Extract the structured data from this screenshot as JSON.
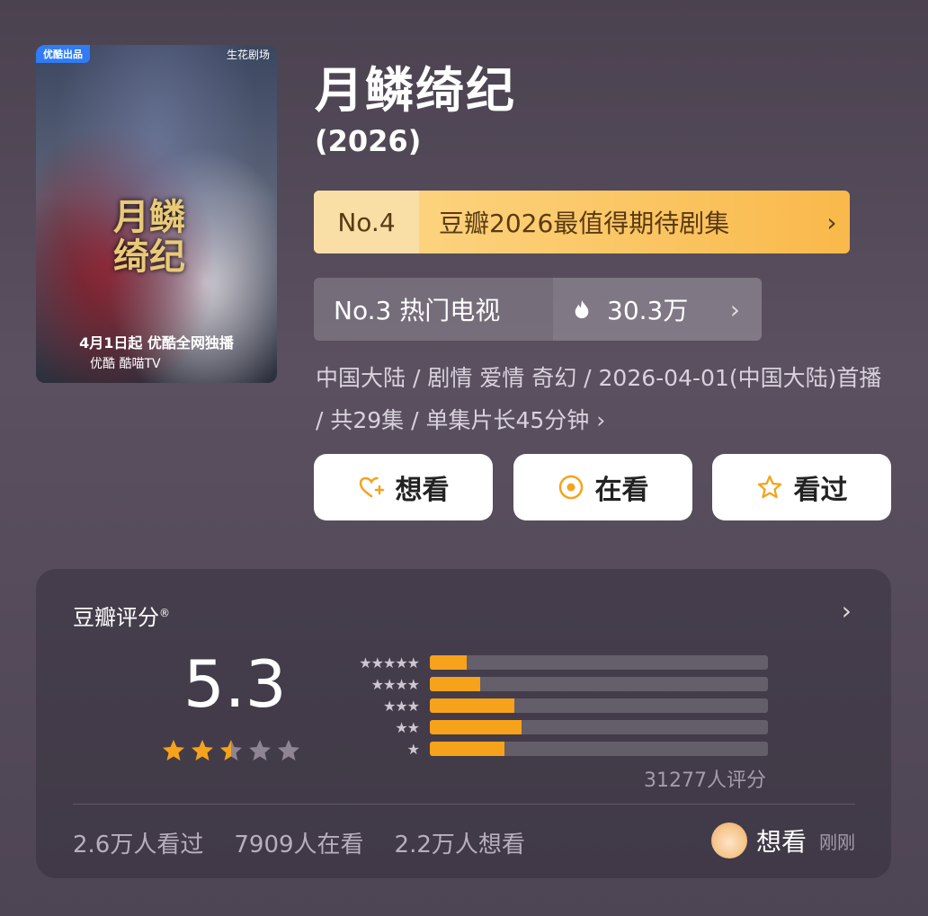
{
  "poster": {
    "badge": "优酷出品",
    "brand": "生花剧场",
    "title_art": "月鳞绮纪",
    "release": "4月1日起 优酷全网独播",
    "platforms": "优酷 酷喵TV"
  },
  "show": {
    "title": "月鳞绮纪",
    "year": "(2026)"
  },
  "rank_main": {
    "num": "No.4",
    "label": "豆瓣2026最值得期待剧集",
    "chevron": "›"
  },
  "rank_sub": {
    "label": "No.3 热门电视",
    "heat": "30.3万",
    "chevron": "›",
    "icon": "flame-icon"
  },
  "meta": {
    "line": "中国大陆 / 剧情 爱情 奇幻 / 2026-04-01(中国大陆)首播 / 共29集 / 单集片长45分钟 ›"
  },
  "actions": [
    {
      "label": "想看",
      "icon": "heart-plus-icon"
    },
    {
      "label": "在看",
      "icon": "circle-dot-icon"
    },
    {
      "label": "看过",
      "icon": "star-outline-icon"
    }
  ],
  "rating": {
    "header": "豆瓣评分",
    "header_mark": "®",
    "more": "›",
    "score": "5.3",
    "stars_value": 2.5,
    "count": "31277人评分",
    "distribution": [
      {
        "stars": "★★★★★",
        "fraction": 0.11
      },
      {
        "stars": "★★★★",
        "fraction": 0.15
      },
      {
        "stars": "★★★",
        "fraction": 0.25
      },
      {
        "stars": "★★",
        "fraction": 0.27
      },
      {
        "stars": "★",
        "fraction": 0.22
      }
    ],
    "stats": [
      "2.6万人看过",
      "7909人在看",
      "2.2万人想看"
    ],
    "friend": {
      "action": "想看",
      "time": "刚刚"
    }
  },
  "colors": {
    "accent": "#f7a21b",
    "rank_bg": "#fbc866",
    "rank_text": "#5a3a12"
  }
}
